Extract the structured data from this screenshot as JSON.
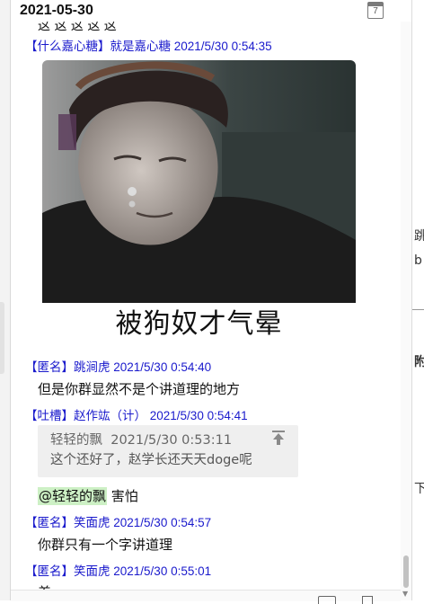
{
  "header": {
    "date": "2021-05-30",
    "calendar_day": "7"
  },
  "top_cut_text": "这 这 这 这 这",
  "messages": [
    {
      "author": "【什么嘉心糖】就是嘉心糖",
      "time": "2021/5/30 0:54:35",
      "type": "image",
      "image_caption": "被狗奴才气晕"
    },
    {
      "author": "【匿名】跳涧虎",
      "time": "2021/5/30 0:54:40",
      "text": "但是你群显然不是个讲道理的地方"
    },
    {
      "author": "【吐槽】赵作竑（计）",
      "time": "2021/5/30 0:54:41",
      "quote": {
        "author": "轻轻的飘",
        "time": "2021/5/30 0:53:11",
        "text": "这个还好了，赵学长还天天doge呢"
      },
      "mention": "@轻轻的飘",
      "text": " 害怕"
    },
    {
      "author": "【匿名】笑面虎",
      "time": "2021/5/30 0:54:57",
      "text": "你群只有一个字讲道理"
    },
    {
      "author": "【匿名】笑面虎",
      "time": "2021/5/30 0:55:01",
      "text": "差"
    }
  ],
  "right_window": {
    "t1": "跳",
    "t2": "b",
    "t3": "附",
    "t4": "下"
  },
  "colors": {
    "author": "#1a1acc",
    "mention_bg": "#cdf0c5",
    "quote_bg": "#efefef"
  }
}
